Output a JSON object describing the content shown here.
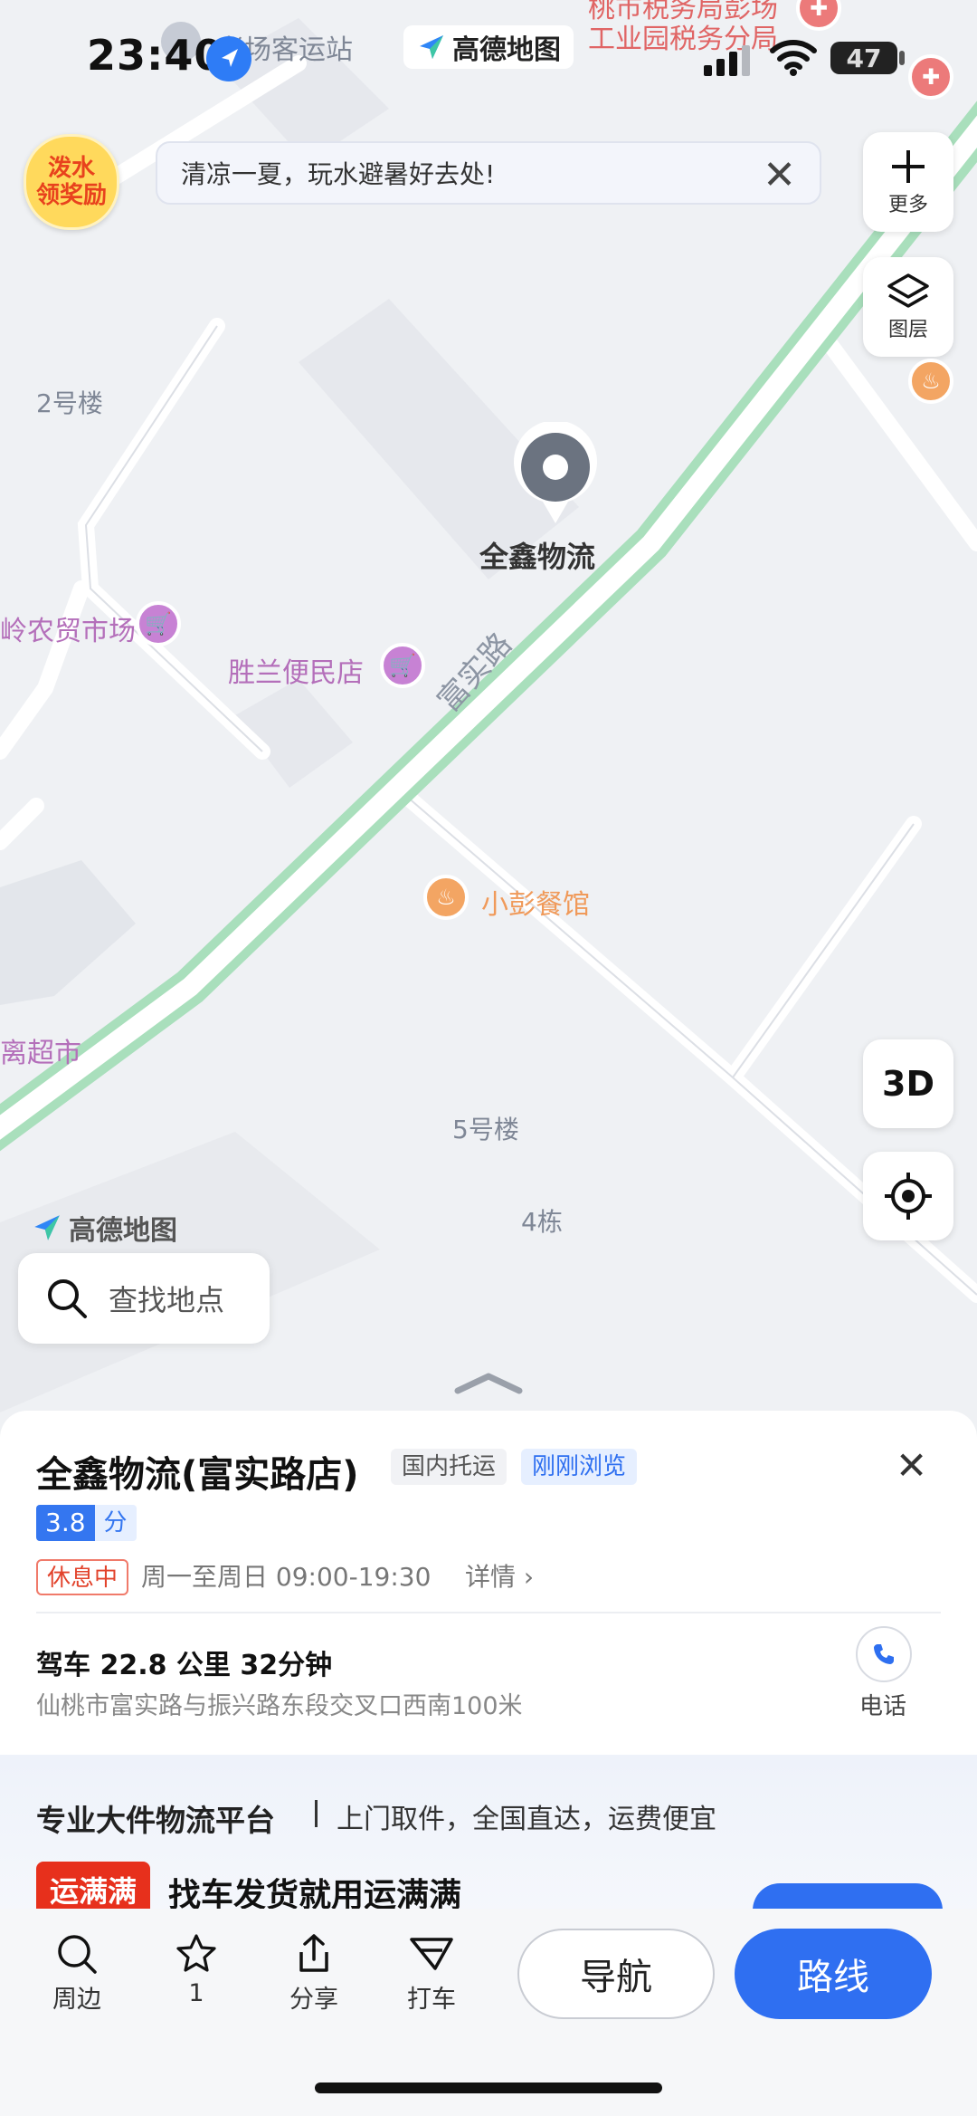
{
  "status_bar": {
    "time": "23:40",
    "battery": "47"
  },
  "app": {
    "name": "高德地图"
  },
  "promo": {
    "badge_line1": "泼水",
    "badge_line2": "领奖励",
    "banner_text": "清凉一夏，玩水避暑好去处!"
  },
  "controls": {
    "more_label": "更多",
    "layers_label": "图层",
    "three_d_label": "3D"
  },
  "map": {
    "pin_name": "全鑫物流",
    "road_name": "富实路",
    "labels": {
      "top_station": "老场客运站",
      "top_tax1": "桃市税务局彭场",
      "top_tax2": "工业园税务分局",
      "building2": "2号楼",
      "farm_market": "岭农贸市场",
      "shenglan": "胜兰便民店",
      "restaurant": "小彭餐馆",
      "supermarket": "离超市",
      "building5": "5号楼",
      "building4": "4栋"
    },
    "watermark": "高德地图"
  },
  "search": {
    "placeholder": "查找地点"
  },
  "place": {
    "title": "全鑫物流(富实路店)",
    "tag_category": "国内托运",
    "tag_recent": "刚刚浏览",
    "rating": "3.8",
    "rating_unit": "分",
    "status": "休息中",
    "hours": "周一至周日 09:00-19:30",
    "detail": "详情",
    "drive": "驾车 22.8 公里 32分钟",
    "address": "仙桃市富实路与振兴路东段交叉口西南100米",
    "phone_label": "电话"
  },
  "ad": {
    "title": "专业大件物流平台",
    "subtitle": "上门取件，全国直达，运费便宜",
    "logo": "运满满",
    "text": "找车发货就用运满满"
  },
  "toolbar": {
    "nearby": "周边",
    "favorite": "1",
    "share": "分享",
    "taxi": "打车",
    "navigate": "导航",
    "route": "路线"
  }
}
